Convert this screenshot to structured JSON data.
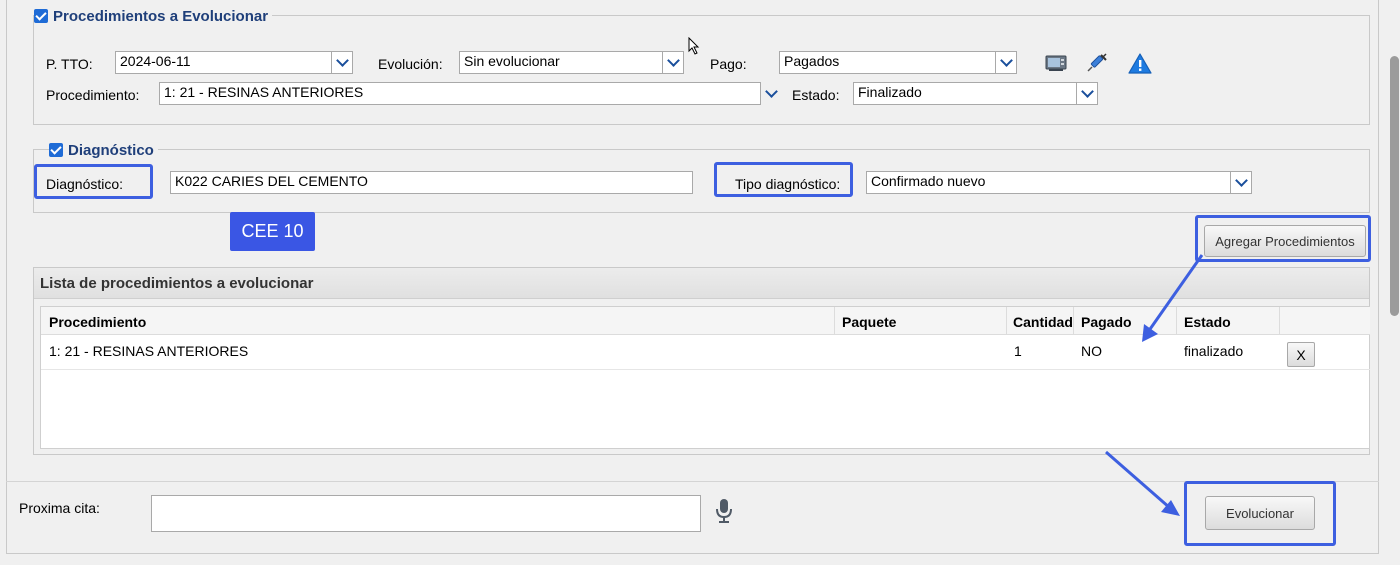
{
  "procedimientos_section": {
    "title": "Procedimientos a Evolucionar",
    "checked": true
  },
  "filters": {
    "ptto_label": "P. TTO:",
    "ptto_value": "2024-06-11",
    "evolucion_label": "Evolución:",
    "evolucion_value": "Sin evolucionar",
    "pago_label": "Pago:",
    "pago_value": "Pagados",
    "procedimiento_label": "Procedimiento:",
    "procedimiento_value": "1: 21 - RESINAS ANTERIORES",
    "estado_label": "Estado:",
    "estado_value": "Finalizado"
  },
  "toolbar_icons": [
    "monitor-icon",
    "syringe-icon",
    "warning-icon"
  ],
  "diagnostico_section": {
    "title": "Diagnóstico",
    "checked": true,
    "diagnostico_label": "Diagnóstico:",
    "diagnostico_value": "K022 CARIES DEL CEMENTO",
    "tipo_label": "Tipo diagnóstico:",
    "tipo_value": "Confirmado nuevo",
    "badge": "CEE 10"
  },
  "agregar_button": "Agregar Procedimientos",
  "lista": {
    "title": "Lista de procedimientos a evolucionar",
    "columns": [
      "Procedimiento",
      "Paquete",
      "Cantidad",
      "Pagado",
      "Estado"
    ],
    "rows": [
      {
        "procedimiento": "1: 21 - RESINAS ANTERIORES",
        "paquete": "",
        "cantidad": "1",
        "pagado": "NO",
        "estado": "finalizado",
        "delete_label": "X"
      }
    ]
  },
  "proxima_cita": {
    "label": "Proxima cita:",
    "value": ""
  },
  "evolucionar_button": "Evolucionar",
  "colors": {
    "accent": "#3d5fe0",
    "section_title": "#1f3f7a",
    "checkbox": "#1e6bd6"
  }
}
